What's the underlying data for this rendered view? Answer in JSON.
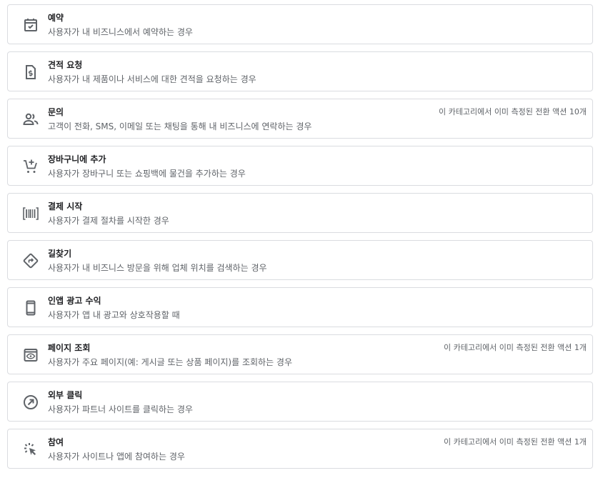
{
  "goals": [
    {
      "title": "예약",
      "description": "사용자가 내 비즈니스에서 예약하는 경우",
      "note": "",
      "icon": "calendar-check-icon"
    },
    {
      "title": "견적 요청",
      "description": "사용자가 내 제품이나 서비스에 대한 견적을 요청하는 경우",
      "note": "",
      "icon": "request-quote-icon"
    },
    {
      "title": "문의",
      "description": "고객이 전화, SMS, 이메일 또는 채팅을 통해 내 비즈니스에 연락하는 경우",
      "note": "이 카테고리에서 이미 측정된 전환 액션 10개",
      "icon": "people-icon"
    },
    {
      "title": "장바구니에 추가",
      "description": "사용자가 장바구니 또는 쇼핑백에 물건을 추가하는 경우",
      "note": "",
      "icon": "add-shopping-cart-icon"
    },
    {
      "title": "결제 시작",
      "description": "사용자가 결제 절차를 시작한 경우",
      "note": "",
      "icon": "barcode-scanner-icon"
    },
    {
      "title": "길찾기",
      "description": "사용자가 내 비즈니스 방문을 위해 업체 위치를 검색하는 경우",
      "note": "",
      "icon": "directions-icon"
    },
    {
      "title": "인앱 광고 수익",
      "description": "사용자가 앱 내 광고와 상호작용할 때",
      "note": "",
      "icon": "smartphone-icon"
    },
    {
      "title": "페이지 조회",
      "description": "사용자가 주요 페이지(예: 게시글 또는 상품 페이지)를 조회하는 경우",
      "note": "이 카테고리에서 이미 측정된 전환 액션 1개",
      "icon": "preview-eye-icon"
    },
    {
      "title": "외부 클릭",
      "description": "사용자가 파트너 사이트를 클릭하는 경우",
      "note": "",
      "icon": "outbound-arrow-icon"
    },
    {
      "title": "참여",
      "description": "사용자가 사이트나 앱에 참여하는 경우",
      "note": "이 카테고리에서 이미 측정된 전환 액션 1개",
      "icon": "ads-click-icon"
    }
  ]
}
